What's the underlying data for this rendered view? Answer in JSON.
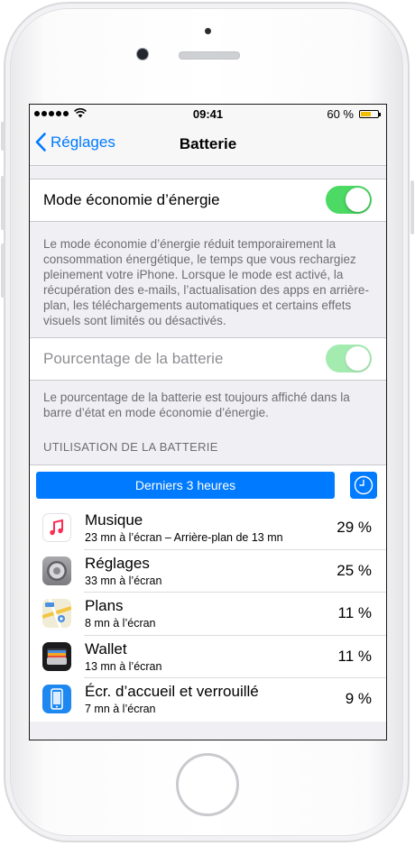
{
  "status_bar": {
    "time": "09:41",
    "battery_percent": "60 %",
    "battery_level": 0.6,
    "battery_color": "#f0c000"
  },
  "nav": {
    "back_label": "Réglages",
    "title": "Batterie"
  },
  "low_power": {
    "label": "Mode économie d’énergie",
    "enabled": true,
    "description": "Le mode économie d’énergie réduit temporairement la consommation énergétique, le temps que vous rechargiez pleinement votre iPhone. Lorsque le mode est activé, la récupération des e-mails, l’actualisation des apps en arrière-plan, les téléchargements automatiques et certains effets visuels sont limités ou désactivés."
  },
  "battery_percentage": {
    "label": "Pourcentage de la batterie",
    "enabled": true,
    "disabled_state": true,
    "description": "Le pourcentage de la batterie est toujours affiché dans la barre d’état en mode économie d’énergie."
  },
  "usage": {
    "section_header": "UTILISATION DE LA BATTERIE",
    "period_label": "Derniers 3 heures",
    "apps": [
      {
        "name": "Musique",
        "detail": "23 mn à l’écran – Arrière-plan de 13 mn",
        "percent": "29 %",
        "icon": "music-icon"
      },
      {
        "name": "Réglages",
        "detail": "33 mn à l’écran",
        "percent": "25 %",
        "icon": "settings-gear-icon"
      },
      {
        "name": "Plans",
        "detail": "8 mn à l’écran",
        "percent": "11 %",
        "icon": "maps-icon"
      },
      {
        "name": "Wallet",
        "detail": "13 mn à l’écran",
        "percent": "11 %",
        "icon": "wallet-icon"
      },
      {
        "name": "Écr. d’accueil et verrouillé",
        "detail": "7 mn à l’écran",
        "percent": "9 %",
        "icon": "home-lock-screen-icon"
      }
    ]
  },
  "colors": {
    "accent": "#007aff",
    "toggle_on": "#4cd964"
  }
}
